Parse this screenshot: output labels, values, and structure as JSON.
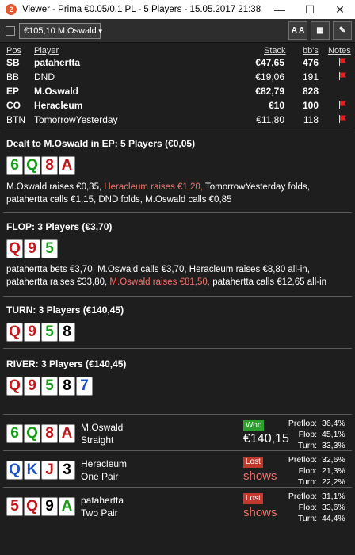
{
  "window": {
    "title": "Viewer - Prima €0.05/0.1 PL - 5 Players - 15.05.2017 21:38",
    "app_icon_label": "2",
    "minimize": "—",
    "maximize": "☐",
    "close": "✕"
  },
  "toolbar": {
    "player_select": "€105,10 M.Oswald",
    "font_button": "A A",
    "grid_button": "▦",
    "edit_button": "✎"
  },
  "players_table": {
    "headers": {
      "pos": "Pos",
      "player": "Player",
      "stack": "Stack",
      "bbs": "bb's",
      "notes": "Notes"
    },
    "rows": [
      {
        "pos": "SB",
        "player": "patahertta",
        "stack": "€47,65",
        "bbs": "476",
        "bold": true,
        "flag": true
      },
      {
        "pos": "BB",
        "player": "DND",
        "stack": "€19,06",
        "bbs": "191",
        "bold": false,
        "flag": true
      },
      {
        "pos": "EP",
        "player": "M.Oswald",
        "stack": "€82,79",
        "bbs": "828",
        "bold": true,
        "flag": false
      },
      {
        "pos": "CO",
        "player": "Heracleum",
        "stack": "€10",
        "bbs": "100",
        "bold": true,
        "flag": true
      },
      {
        "pos": "BTN",
        "player": "TomorrowYesterday",
        "stack": "€11,80",
        "bbs": "118",
        "bold": false,
        "flag": true
      }
    ]
  },
  "preflop": {
    "title": "Dealt to M.Oswald in EP: 5 Players (€0,05)",
    "cards": [
      {
        "r": "6",
        "c": "#1a9a1a"
      },
      {
        "r": "Q",
        "c": "#1a9a1a"
      },
      {
        "r": "8",
        "c": "#c0181c"
      },
      {
        "r": "A",
        "c": "#c0181c"
      }
    ],
    "actions": [
      {
        "t": "M.Oswald raises €0,35, ",
        "hl": false
      },
      {
        "t": "Heracleum raises €1,20, ",
        "hl": true
      },
      {
        "t": "TomorrowYesterday folds, patahertta calls €1,15, DND folds, M.Oswald calls €0,85",
        "hl": false
      }
    ]
  },
  "flop": {
    "title": "FLOP: 3 Players (€3,70)",
    "cards": [
      {
        "r": "Q",
        "c": "#c0181c"
      },
      {
        "r": "9",
        "c": "#c0181c"
      },
      {
        "r": "5",
        "c": "#1a9a1a"
      }
    ],
    "actions": [
      {
        "t": "patahertta bets €3,70, M.Oswald calls €3,70, Heracleum raises €8,80 all-in, patahertta raises €33,80, ",
        "hl": false
      },
      {
        "t": "M.Oswald raises €81,50, ",
        "hl": true
      },
      {
        "t": "patahertta calls €12,65 all-in",
        "hl": false
      }
    ]
  },
  "turn": {
    "title": "TURN: 3 Players (€140,45)",
    "cards": [
      {
        "r": "Q",
        "c": "#c0181c"
      },
      {
        "r": "9",
        "c": "#c0181c"
      },
      {
        "r": "5",
        "c": "#1a9a1a"
      },
      {
        "r": "8",
        "c": "#000000"
      }
    ]
  },
  "river": {
    "title": "RIVER: 3 Players (€140,45)",
    "cards": [
      {
        "r": "Q",
        "c": "#c0181c"
      },
      {
        "r": "9",
        "c": "#c0181c"
      },
      {
        "r": "5",
        "c": "#1a9a1a"
      },
      {
        "r": "8",
        "c": "#000000"
      },
      {
        "r": "7",
        "c": "#1c4fc0"
      }
    ]
  },
  "results": [
    {
      "cards": [
        {
          "r": "6",
          "c": "#1a9a1a"
        },
        {
          "r": "Q",
          "c": "#1a9a1a"
        },
        {
          "r": "8",
          "c": "#c0181c"
        },
        {
          "r": "A",
          "c": "#c0181c"
        }
      ],
      "name": "M.Oswald",
      "hand": "Straight",
      "badge": "Won",
      "won": true,
      "value": "€140,15",
      "eq": [
        {
          "l": "Preflop:",
          "v": "36,4%"
        },
        {
          "l": "Flop:",
          "v": "45,1%"
        },
        {
          "l": "Turn:",
          "v": "33,3%"
        }
      ]
    },
    {
      "cards": [
        {
          "r": "Q",
          "c": "#1c4fc0"
        },
        {
          "r": "K",
          "c": "#1c4fc0"
        },
        {
          "r": "J",
          "c": "#c0181c"
        },
        {
          "r": "3",
          "c": "#000000"
        }
      ],
      "name": "Heracleum",
      "hand": "One Pair",
      "badge": "Lost",
      "won": false,
      "value": "shows",
      "eq": [
        {
          "l": "Preflop:",
          "v": "32,6%"
        },
        {
          "l": "Flop:",
          "v": "21,3%"
        },
        {
          "l": "Turn:",
          "v": "22,2%"
        }
      ]
    },
    {
      "cards": [
        {
          "r": "5",
          "c": "#c0181c"
        },
        {
          "r": "Q",
          "c": "#c0181c"
        },
        {
          "r": "9",
          "c": "#000000"
        },
        {
          "r": "A",
          "c": "#1a9a1a"
        }
      ],
      "name": "patahertta",
      "hand": "Two Pair",
      "badge": "Lost",
      "won": false,
      "value": "shows",
      "eq": [
        {
          "l": "Preflop:",
          "v": "31,1%"
        },
        {
          "l": "Flop:",
          "v": "33,6%"
        },
        {
          "l": "Turn:",
          "v": "44,4%"
        }
      ]
    }
  ]
}
